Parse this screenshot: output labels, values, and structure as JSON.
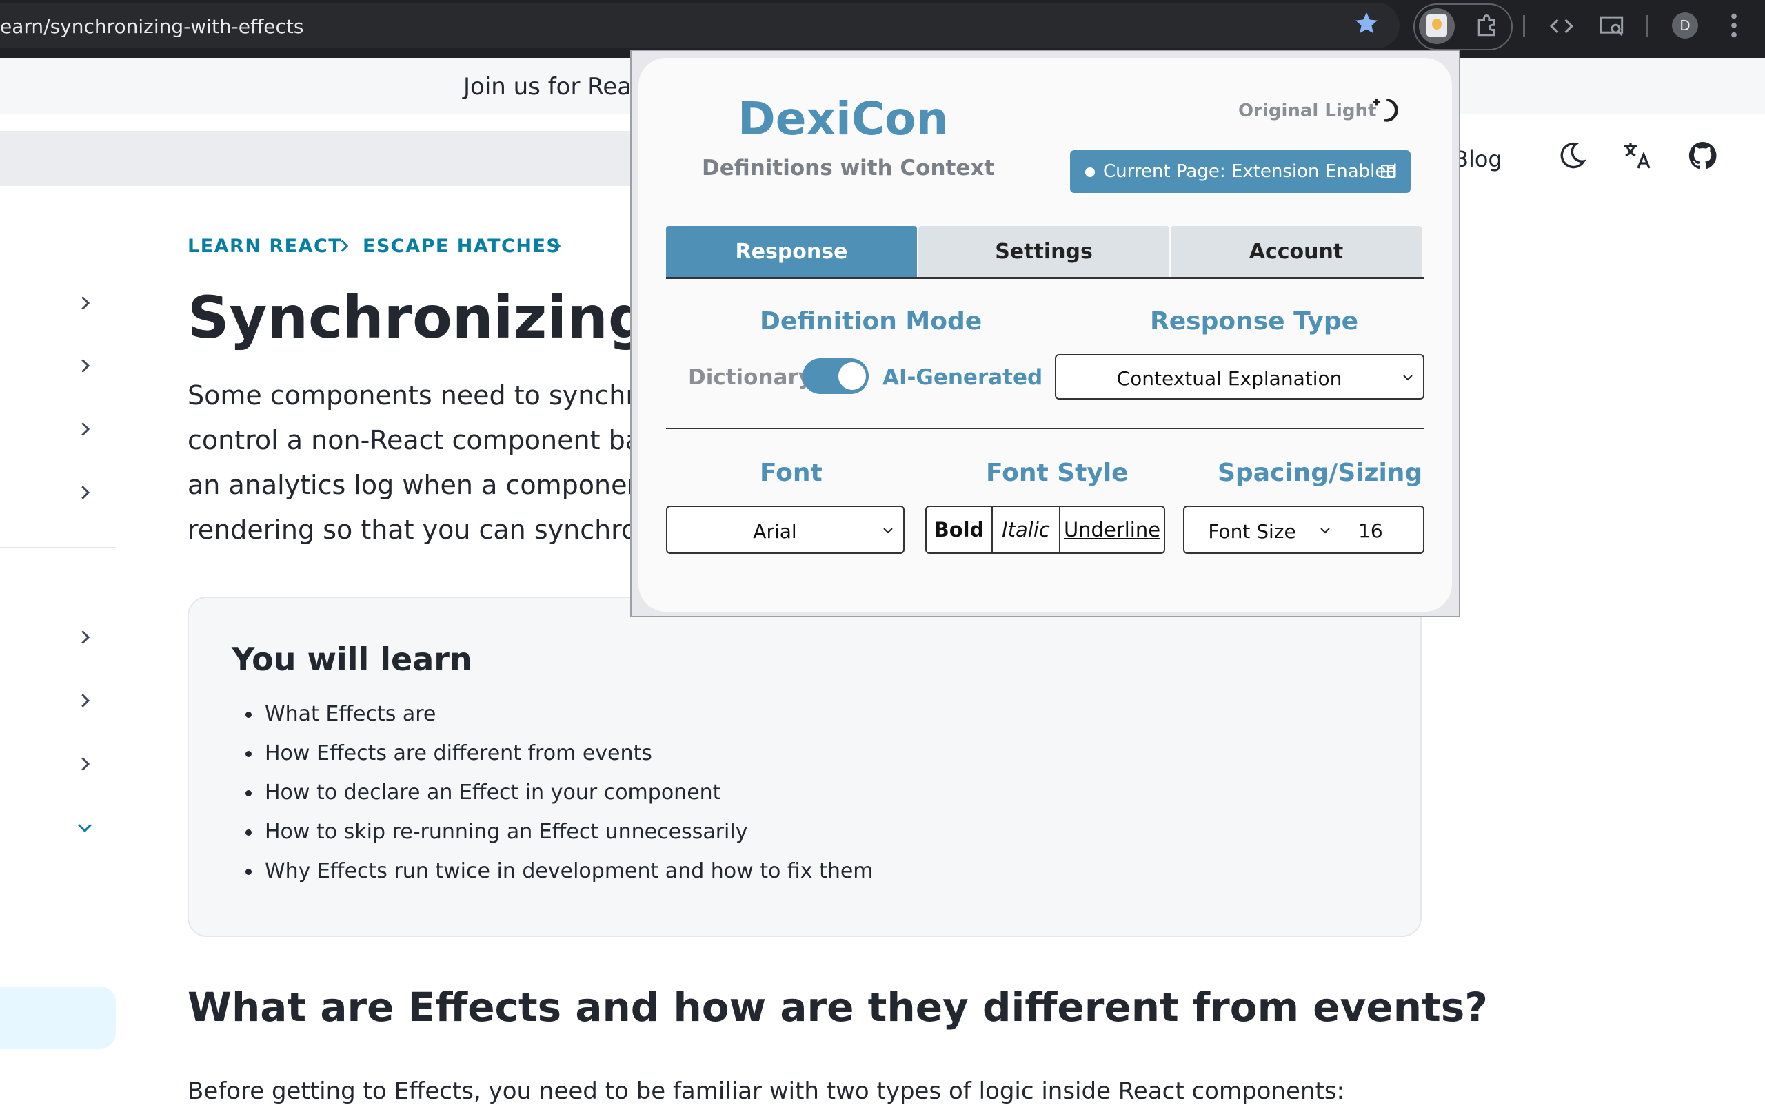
{
  "browser": {
    "url": "earn/synchronizing-with-effects",
    "profile_initial": "D"
  },
  "page": {
    "banner": "Join us for Rea",
    "nav": {
      "blog": "Blog"
    },
    "breadcrumbs": [
      "LEARN REACT",
      "ESCAPE HATCHES"
    ],
    "title": "Synchronizing wi",
    "intro": [
      "Some components need to synchr",
      "control a non-React component ba",
      "an analytics log when a component",
      "rendering so that you can synchror"
    ],
    "learn": {
      "title": "You will learn",
      "items": [
        "What Effects are",
        "How Effects are different from events",
        "How to declare an Effect in your component",
        "How to skip re-running an Effect unnecessarily",
        "Why Effects run twice in development and how to fix them"
      ]
    },
    "h2": "What are Effects and how are they different from events?",
    "paragraph": "Before getting to Effects, you need to be familiar with two types of logic inside React components:"
  },
  "popup": {
    "brand": "DexiCon",
    "tagline": "Definitions with Context",
    "theme": "Original Light",
    "status": "Current Page: Extension Enabled",
    "tabs": [
      "Response",
      "Settings",
      "Account"
    ],
    "active_tab": "Response",
    "definition_mode": {
      "heading": "Definition Mode",
      "left": "Dictionary",
      "right": "AI-Generated",
      "ai_enabled": true
    },
    "response_type": {
      "heading": "Response Type",
      "value": "Contextual Explanation"
    },
    "font": {
      "heading": "Font",
      "value": "Arial"
    },
    "font_style": {
      "heading": "Font Style",
      "bold": "Bold",
      "italic": "Italic",
      "underline": "Underline"
    },
    "spacing": {
      "heading": "Spacing/Sizing",
      "select": "Font Size",
      "value": "16"
    },
    "colors": {
      "accent": "#4e90b6",
      "tab_inactive": "#dde2e6",
      "muted": "#8a8f96"
    }
  }
}
